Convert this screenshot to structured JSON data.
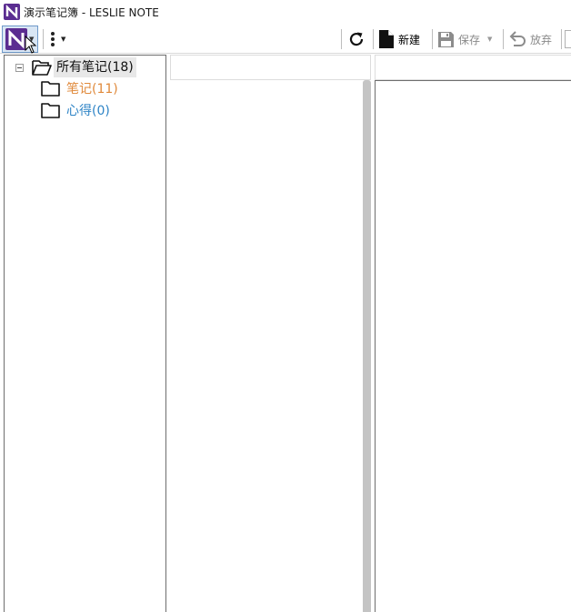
{
  "window": {
    "title": "演示笔记簿 - LESLIE NOTE",
    "logo_icon": "leslie-note-logo",
    "brand_color": "#5b2d91"
  },
  "toolbar": {
    "app_menu_icon": "leslie-note-logo",
    "more_icon": "vertical-ellipsis-icon",
    "refresh_icon": "refresh-icon",
    "new_label": "新建",
    "save_label": "保存",
    "discard_label": "放弃"
  },
  "tree": {
    "root": {
      "label": "所有笔记(18)",
      "icon": "folder-open-icon"
    },
    "children": [
      {
        "label": "笔记(11)",
        "icon": "folder-icon",
        "color": "#e08a3c"
      },
      {
        "label": "心得(0)",
        "icon": "folder-icon",
        "color": "#2e84c6"
      }
    ]
  }
}
